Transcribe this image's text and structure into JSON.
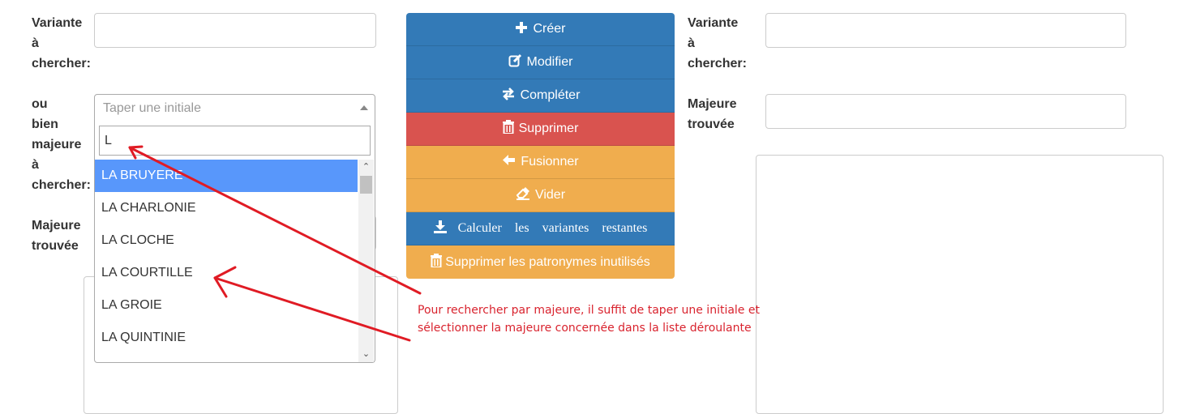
{
  "left_form": {
    "variante_label": "Variante\nà\nchercher:",
    "ou_label": "ou\nbien\nmajeure\nà\nchercher:",
    "majeure_label": "Majeure\ntrouvée"
  },
  "right_form": {
    "variante_label": "Variante\nà\nchercher:",
    "majeure_label": "Majeure\ntrouvée"
  },
  "combo": {
    "placeholder": "Taper une initiale",
    "search_value": "L",
    "options": [
      "LA BRUYERE",
      "LA CHARLONIE",
      "LA CLOCHE",
      "LA COURTILLE",
      "LA GROIE",
      "LA QUINTINIE"
    ],
    "highlighted": "LA BRUYERE"
  },
  "buttons": {
    "creer": "Créer",
    "modifier": "Modifier",
    "completer": "Compléter",
    "supprimer": "Supprimer",
    "fusionner": "Fusionner",
    "vider": "Vider",
    "calculer": "Calculer les variantes restantes",
    "supprimer_patronymes": "Supprimer les patronymes inutilisés"
  },
  "annotation": {
    "line1": "Pour rechercher par majeure, il suffit de taper une initiale et",
    "line2": "sélectionner la majeure concernée dans la liste déroulante",
    "color": "#d9232e"
  },
  "colors": {
    "primary": "#337ab7",
    "danger": "#d9534f",
    "warning": "#f0ad4e",
    "highlight": "#5897fb"
  }
}
